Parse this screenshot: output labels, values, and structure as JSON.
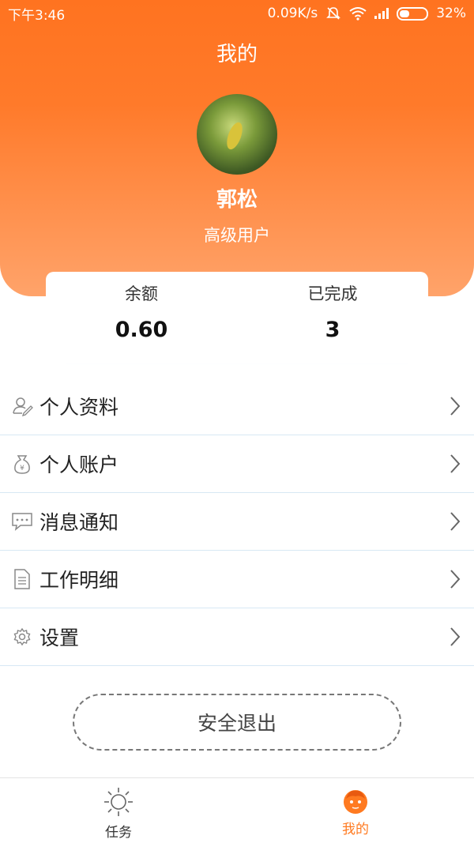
{
  "status_bar": {
    "time": "下午3:46",
    "net_speed": "0.09K/s",
    "battery": "32%"
  },
  "header": {
    "title": "我的",
    "username": "郭松",
    "level": "高级用户"
  },
  "stats": {
    "balance_label": "余额",
    "balance_value": "0.60",
    "completed_label": "已完成",
    "completed_value": "3"
  },
  "menu": {
    "items": [
      {
        "label": "个人资料",
        "icon": "user-edit-icon"
      },
      {
        "label": "个人账户",
        "icon": "money-bag-icon"
      },
      {
        "label": "消息通知",
        "icon": "chat-bubble-icon"
      },
      {
        "label": "工作明细",
        "icon": "document-icon"
      },
      {
        "label": "设置",
        "icon": "gear-icon"
      }
    ]
  },
  "logout_label": "安全退出",
  "tabbar": {
    "tabs": [
      {
        "label": "任务",
        "icon": "sun-icon"
      },
      {
        "label": "我的",
        "icon": "face-icon"
      }
    ]
  },
  "colors": {
    "accent": "#ff7a20",
    "divider": "#d7e8f4"
  }
}
